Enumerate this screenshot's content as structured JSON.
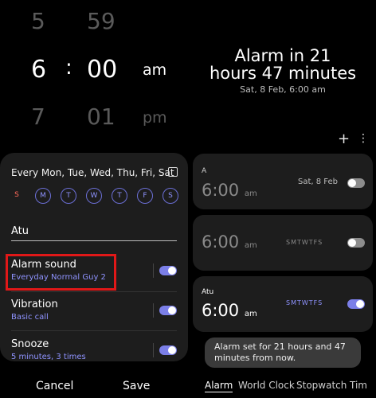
{
  "picker": {
    "hour_prev": "5",
    "minute_prev": "59",
    "hour": "6",
    "separator": ":",
    "minute": "00",
    "ampm": "am",
    "hour_next": "7",
    "minute_next": "01",
    "ampm_next": "pm"
  },
  "header": {
    "line1": "Alarm in 21",
    "line2": "hours 47 minutes",
    "sub": "Sat, 8 Feb, 6:00 am",
    "add_icon": "plus-icon",
    "more_icon": "more-vertical-icon"
  },
  "editor": {
    "repeat_label": "Every Mon, Tue, Wed, Thu, Fri, Sat",
    "days": [
      {
        "label": "S",
        "selected": false
      },
      {
        "label": "M",
        "selected": true
      },
      {
        "label": "T",
        "selected": true
      },
      {
        "label": "W",
        "selected": true
      },
      {
        "label": "T",
        "selected": true
      },
      {
        "label": "F",
        "selected": true
      },
      {
        "label": "S",
        "selected": true
      }
    ],
    "name_value": "Atu",
    "alarm_sound": {
      "title": "Alarm sound",
      "value": "Everyday Normal Guy 2",
      "enabled": true
    },
    "vibration": {
      "title": "Vibration",
      "value": "Basic call",
      "enabled": true
    },
    "snooze": {
      "title": "Snooze",
      "value": "5 minutes, 3 times",
      "enabled": true
    }
  },
  "alarms": [
    {
      "label": "A",
      "time": "6:00",
      "ampm": "am",
      "date": "Sat, 8 Feb",
      "enabled": false
    },
    {
      "label": "",
      "time": "6:00",
      "ampm": "am",
      "days": "SMTWTFS",
      "enabled": false
    },
    {
      "label": "Atu",
      "time": "6:00",
      "ampm": "am",
      "days": "SMTWTFS",
      "enabled": true
    }
  ],
  "toast": {
    "line1": "Alarm set for 21 hours and 47",
    "line2": "minutes from now."
  },
  "bottom": {
    "cancel": "Cancel",
    "save": "Save"
  },
  "tabs": [
    "Alarm",
    "World Clock",
    "Stopwatch",
    "Tim"
  ],
  "colors": {
    "accent": "#7b7fe8",
    "sunday": "#ff6a5a",
    "highlight": "#e01818"
  }
}
